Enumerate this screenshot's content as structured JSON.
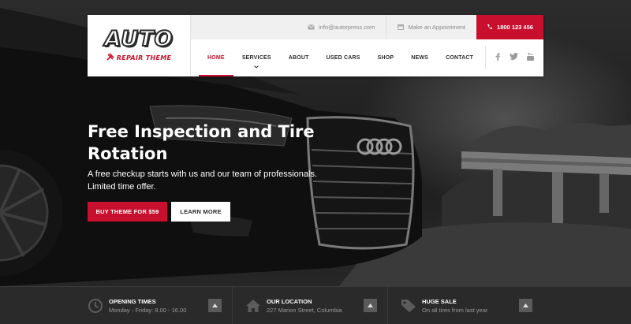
{
  "brand": {
    "logo_text": "AUTO",
    "logo_sub": "REPAIR THEME",
    "logo_icon": "wrench-hammer-icon"
  },
  "topbar": {
    "email": "info@autorpress.com",
    "email_icon": "envelope-icon",
    "appointment": "Make an Appointment",
    "appointment_icon": "calendar-icon",
    "phone": "1800 123 456",
    "phone_icon": "phone-icon"
  },
  "nav": {
    "items": [
      {
        "label": "HOME",
        "active": true
      },
      {
        "label": "SERVICES",
        "dropdown": true
      },
      {
        "label": "ABOUT"
      },
      {
        "label": "USED CARS"
      },
      {
        "label": "SHOP"
      },
      {
        "label": "NEWS"
      },
      {
        "label": "CONTACT"
      }
    ],
    "social": [
      "facebook-icon",
      "twitter-icon",
      "youtube-icon"
    ]
  },
  "hero": {
    "title": "Free Inspection and Tire Rotation",
    "text": "A free checkup starts with us and our team of professionals. Limited time offer.",
    "buy_label": "BUY THEME FOR $59",
    "more_label": "LEARN MORE"
  },
  "info": [
    {
      "icon": "clock-icon",
      "title": "OPENING TIMES",
      "sub": "Monday - Friday: 8.00 - 16.00"
    },
    {
      "icon": "home-icon",
      "title": "OUR LOCATION",
      "sub": "227 Marion Street, Columbia"
    },
    {
      "icon": "tag-icon",
      "title": "HUGE SALE",
      "sub": "On all tires from last year"
    }
  ],
  "colors": {
    "accent": "#c8102e",
    "infobar": "#2a2a2a",
    "topbar": "#f0f0f0"
  }
}
